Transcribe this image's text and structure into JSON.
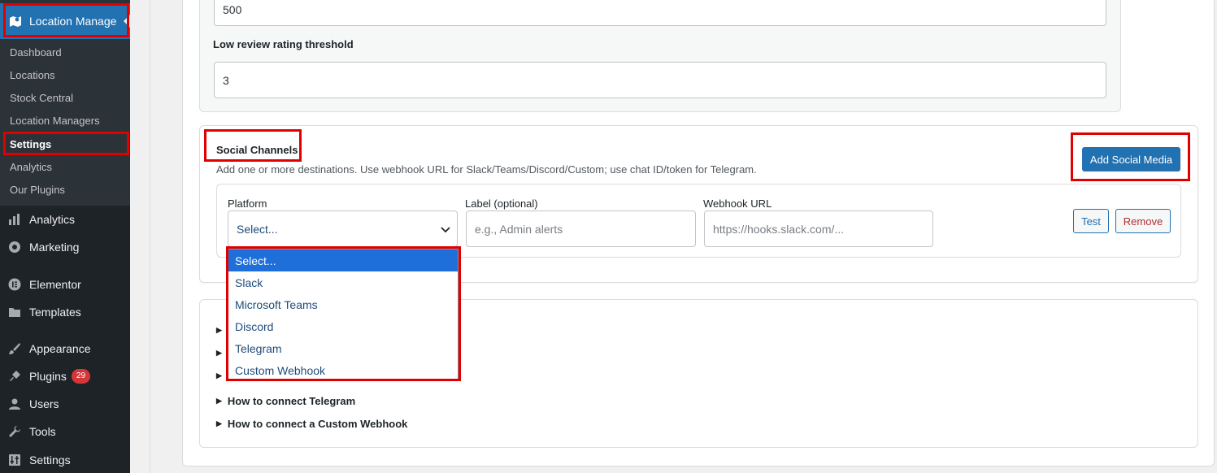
{
  "sidebar": {
    "plugin_menu_title": "Location Manage",
    "submenu": [
      "Dashboard",
      "Locations",
      "Stock Central",
      "Location Managers",
      "Settings",
      "Analytics",
      "Our Plugins"
    ],
    "main_items": [
      "Analytics",
      "Marketing",
      "Elementor",
      "Templates",
      "Appearance",
      "Plugins",
      "Users",
      "Tools",
      "Settings"
    ],
    "plugins_badge": "29"
  },
  "thresholds": {
    "first_value": "500",
    "low_review_label": "Low review rating threshold",
    "low_review_value": "3"
  },
  "social": {
    "title": "Social Channels",
    "description": "Add one or more destinations. Use webhook URL for Slack/Teams/Discord/Custom; use chat ID/token for Telegram.",
    "add_button": "Add Social Media",
    "platform_label": "Platform",
    "platform_value": "Select...",
    "label_label": "Label (optional)",
    "label_placeholder": "e.g., Admin alerts",
    "webhook_label": "Webhook URL",
    "webhook_placeholder": "https://hooks.slack.com/...",
    "test_button": "Test",
    "remove_button": "Remove"
  },
  "dropdown_options": [
    "Select...",
    "Slack",
    "Microsoft Teams",
    "Discord",
    "Telegram",
    "Custom Webhook"
  ],
  "help": {
    "telegram": "How to connect Telegram",
    "custom": "How to connect a Custom Webhook"
  },
  "colors": {
    "accent": "#2271b1",
    "highlight": "#e00000",
    "sidebar_bg": "#1d2327"
  }
}
